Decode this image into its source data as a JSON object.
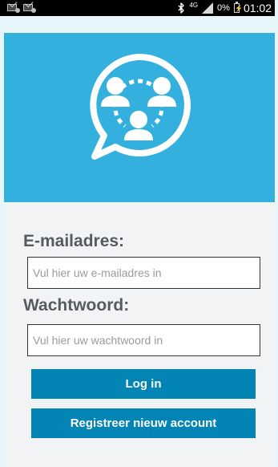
{
  "status_bar": {
    "network": "4G",
    "battery_percent": "0%",
    "time": "01:02",
    "notification_icons": [
      "email-notification-icon",
      "email-notification-icon"
    ],
    "icons": [
      "bluetooth-icon",
      "signal-icon",
      "battery-icon"
    ]
  },
  "colors": {
    "header": "#33b0dd",
    "button": "#0285b5",
    "background": "#f2f3f5",
    "label": "#555b60"
  },
  "logo": {
    "icon": "group-chat-bubble-icon"
  },
  "form": {
    "email_label": "E-mailadres:",
    "email_value": "",
    "email_placeholder": "Vul hier uw e-mailadres in",
    "password_label": "Wachtwoord:",
    "password_value": "",
    "password_placeholder": "Vul hier uw wachtwoord in",
    "login_button": "Log in",
    "register_button": "Registreer nieuw account"
  }
}
